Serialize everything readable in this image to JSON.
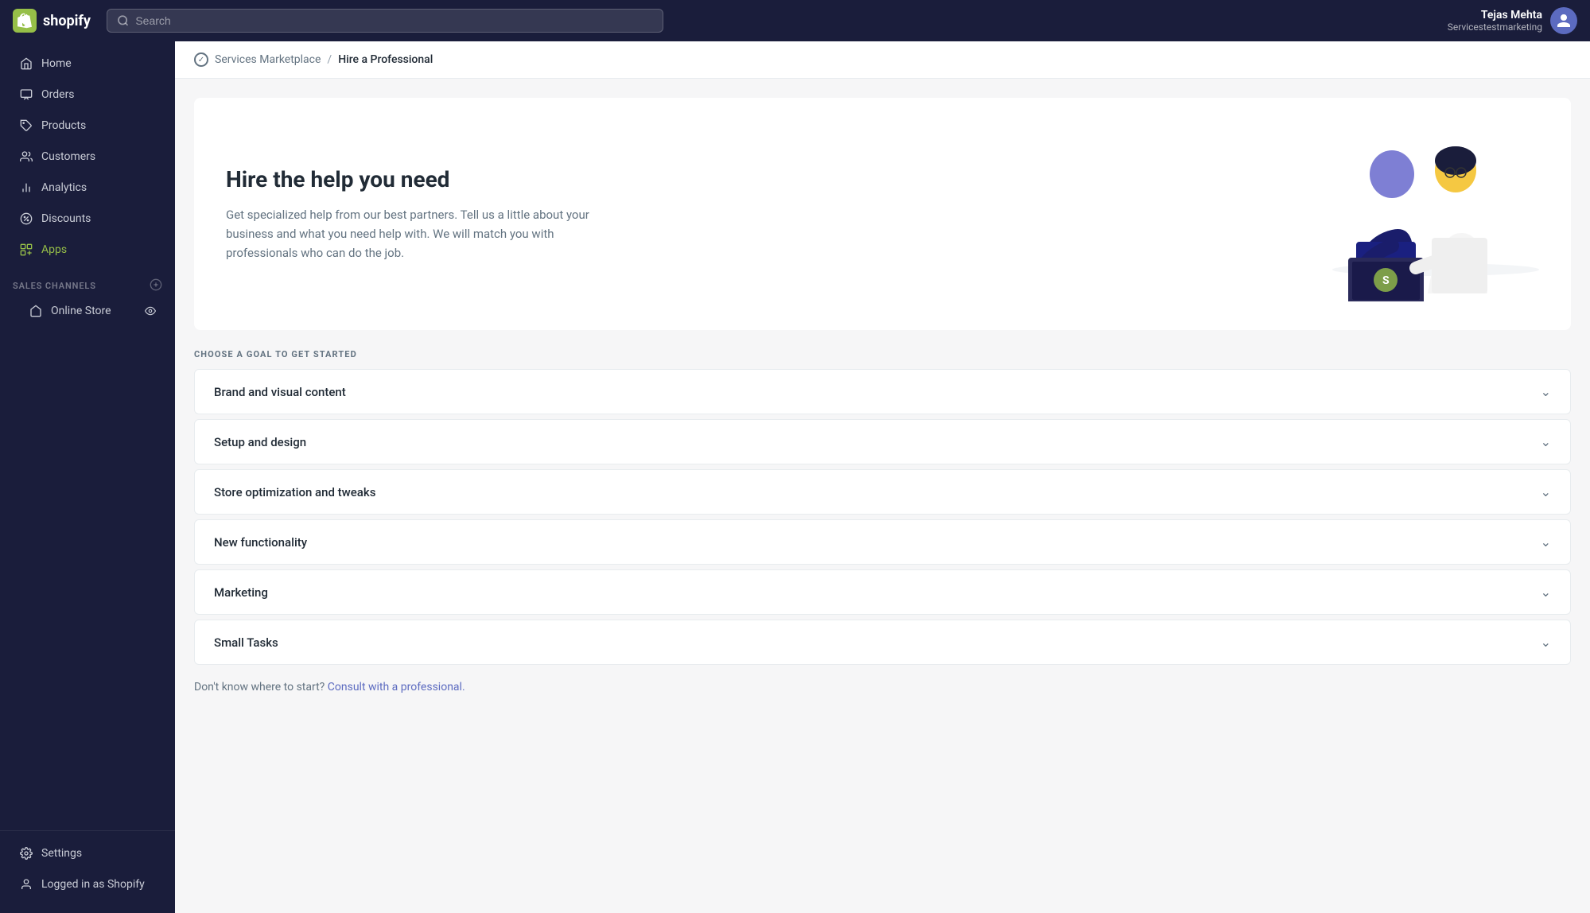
{
  "app": {
    "name": "shopify"
  },
  "topnav": {
    "logo_text": "shopify",
    "search_placeholder": "Search",
    "user_name": "Tejas Mehta",
    "user_store": "Servicestestmarketing"
  },
  "sidebar": {
    "nav_items": [
      {
        "id": "home",
        "label": "Home",
        "icon": "home"
      },
      {
        "id": "orders",
        "label": "Orders",
        "icon": "orders"
      },
      {
        "id": "products",
        "label": "Products",
        "icon": "products"
      },
      {
        "id": "customers",
        "label": "Customers",
        "icon": "customers"
      },
      {
        "id": "analytics",
        "label": "Analytics",
        "icon": "analytics"
      },
      {
        "id": "discounts",
        "label": "Discounts",
        "icon": "discounts"
      },
      {
        "id": "apps",
        "label": "Apps",
        "icon": "apps",
        "active": true
      }
    ],
    "sales_channels_label": "SALES CHANNELS",
    "online_store_label": "Online Store",
    "settings_label": "Settings",
    "logged_in_label": "Logged in as Shopify"
  },
  "breadcrumb": {
    "marketplace_label": "Services Marketplace",
    "separator": "/",
    "current_label": "Hire a Professional"
  },
  "hero": {
    "title": "Hire the help you need",
    "description": "Get specialized help from our best partners. Tell us a little about your business and what you need help with. We will match you with professionals who can do the job."
  },
  "goals": {
    "section_label": "CHOOSE A GOAL TO GET STARTED",
    "items": [
      {
        "id": "brand",
        "label": "Brand and visual content"
      },
      {
        "id": "setup",
        "label": "Setup and design"
      },
      {
        "id": "optimization",
        "label": "Store optimization and tweaks"
      },
      {
        "id": "functionality",
        "label": "New functionality"
      },
      {
        "id": "marketing",
        "label": "Marketing"
      },
      {
        "id": "small-tasks",
        "label": "Small Tasks"
      }
    ]
  },
  "footer": {
    "prompt_text": "Don't know where to start?",
    "link_text": "Consult with a professional.",
    "link_href": "#"
  }
}
